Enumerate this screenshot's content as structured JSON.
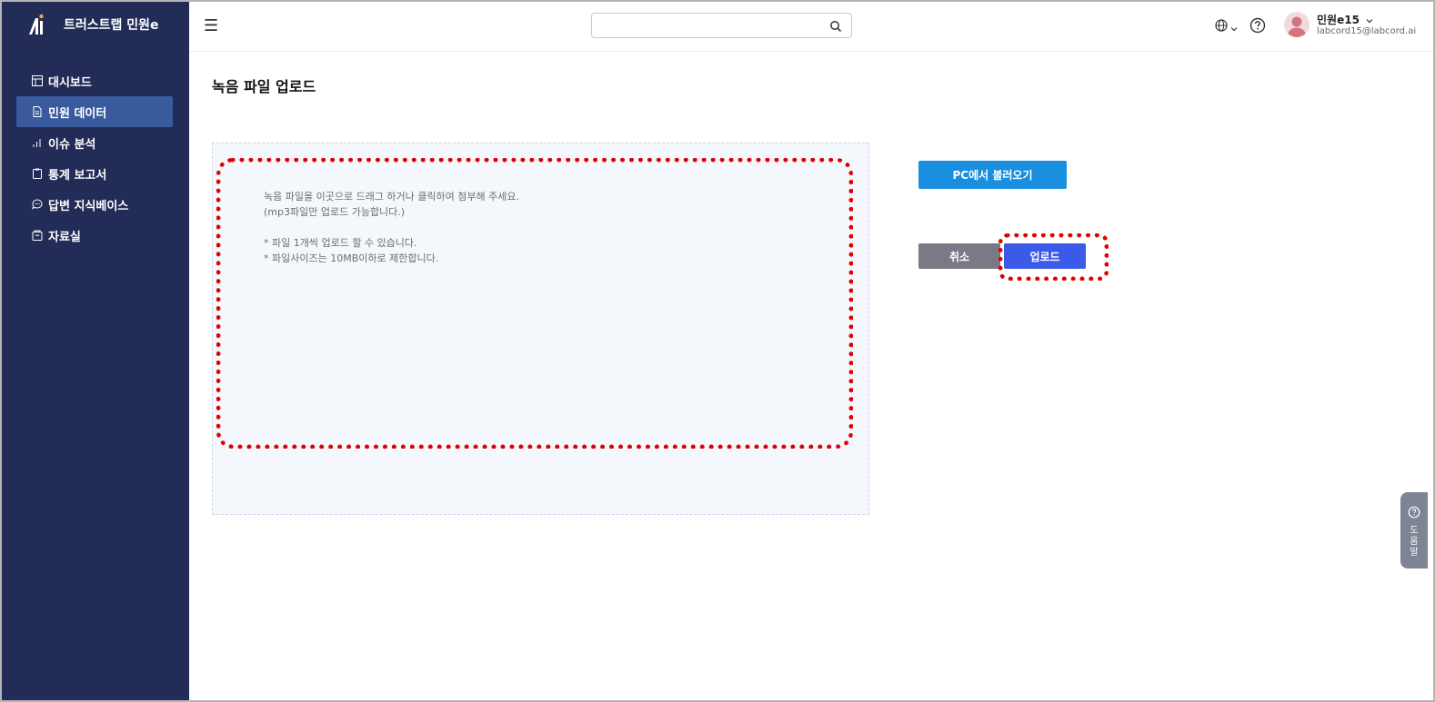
{
  "app": {
    "title": "트러스트랩 민원e"
  },
  "sidebar": {
    "items": [
      {
        "label": "대시보드",
        "icon": "layout-icon",
        "active": false
      },
      {
        "label": "민원 데이터",
        "icon": "document-icon",
        "active": true
      },
      {
        "label": "이슈 분석",
        "icon": "bar-chart-icon",
        "active": false
      },
      {
        "label": "통계 보고서",
        "icon": "clipboard-icon",
        "active": false
      },
      {
        "label": "답변 지식베이스",
        "icon": "chat-icon",
        "active": false
      },
      {
        "label": "자료실",
        "icon": "archive-icon",
        "active": false
      }
    ]
  },
  "header": {
    "search": {
      "value": "",
      "placeholder": ""
    },
    "user": {
      "name": "민원e15",
      "email": "labcord15@labcord.ai"
    }
  },
  "main": {
    "title": "녹음 파일 업로드",
    "dropzone": {
      "line1": "녹음 파일을 이곳으로 드래그 하거나 클릭하여 첨부해 주세요.",
      "line2": "(mp3파일만 업로드 가능합니다.)",
      "note1": "* 파일 1개씩 업로드 할 수 있습니다.",
      "note2": "* 파일사이즈는 10MB이하로 제한합니다."
    },
    "buttons": {
      "load_pc": "PC에서 불러오기",
      "cancel": "취소",
      "upload": "업로드"
    }
  },
  "help_tab": {
    "label": "도움말"
  },
  "colors": {
    "sidebar_bg": "#232c57",
    "active_item": "#3a5a9e",
    "primary_blue": "#1a8fe0",
    "upload_blue": "#3b5ae8",
    "cancel_gray": "#7a7a86",
    "annotation_red": "#e00000"
  }
}
